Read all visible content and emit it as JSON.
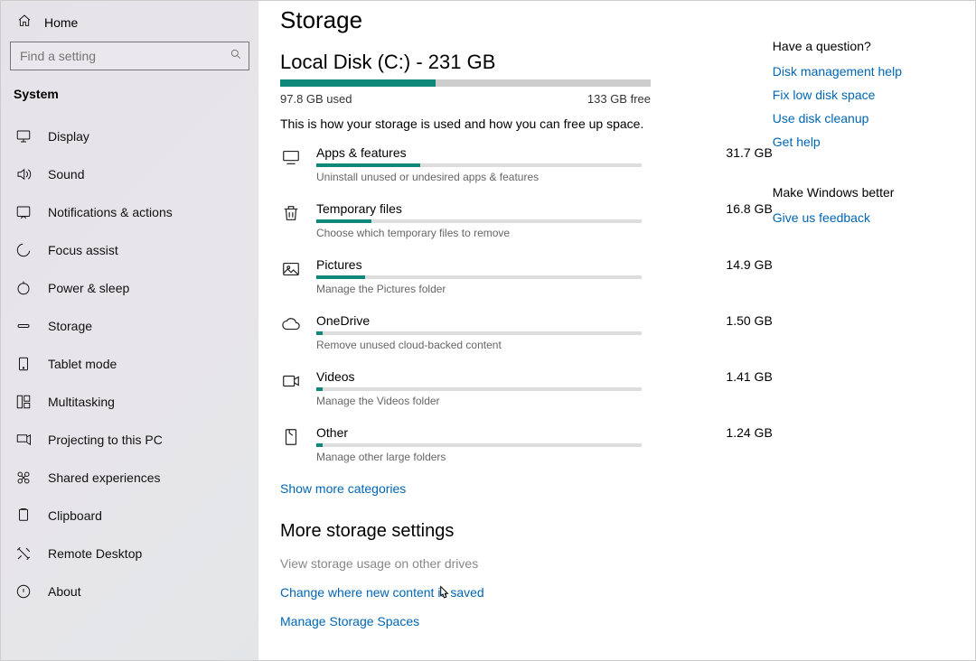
{
  "sidebar": {
    "home": "Home",
    "search_placeholder": "Find a setting",
    "section": "System",
    "items": [
      {
        "label": "Display"
      },
      {
        "label": "Sound"
      },
      {
        "label": "Notifications & actions"
      },
      {
        "label": "Focus assist"
      },
      {
        "label": "Power & sleep"
      },
      {
        "label": "Storage"
      },
      {
        "label": "Tablet mode"
      },
      {
        "label": "Multitasking"
      },
      {
        "label": "Projecting to this PC"
      },
      {
        "label": "Shared experiences"
      },
      {
        "label": "Clipboard"
      },
      {
        "label": "Remote Desktop"
      },
      {
        "label": "About"
      }
    ]
  },
  "page": {
    "title": "Storage",
    "disk": "Local Disk (C:) - 231 GB",
    "used": "97.8 GB used",
    "free": "133 GB free",
    "used_pct": 42,
    "desc": "This is how your storage is used and how you can free up space."
  },
  "categories": [
    {
      "name": "Apps & features",
      "size": "31.7 GB",
      "sub": "Uninstall unused or undesired apps & features",
      "pct": 32
    },
    {
      "name": "Temporary files",
      "size": "16.8 GB",
      "sub": "Choose which temporary files to remove",
      "pct": 17
    },
    {
      "name": "Pictures",
      "size": "14.9 GB",
      "sub": "Manage the Pictures folder",
      "pct": 15
    },
    {
      "name": "OneDrive",
      "size": "1.50 GB",
      "sub": "Remove unused cloud-backed content",
      "pct": 2
    },
    {
      "name": "Videos",
      "size": "1.41 GB",
      "sub": "Manage the Videos folder",
      "pct": 2
    },
    {
      "name": "Other",
      "size": "1.24 GB",
      "sub": "Manage other large folders",
      "pct": 2
    }
  ],
  "show_more": "Show more categories",
  "more": {
    "title": "More storage settings",
    "items": [
      {
        "label": "View storage usage on other drives",
        "muted": true
      },
      {
        "label": "Change where new content is saved"
      },
      {
        "label": "Manage Storage Spaces"
      }
    ]
  },
  "right": {
    "question": "Have a question?",
    "qlinks": [
      "Disk management help",
      "Fix low disk space",
      "Use disk cleanup",
      "Get help"
    ],
    "better": "Make Windows better",
    "feedback": "Give us feedback"
  }
}
